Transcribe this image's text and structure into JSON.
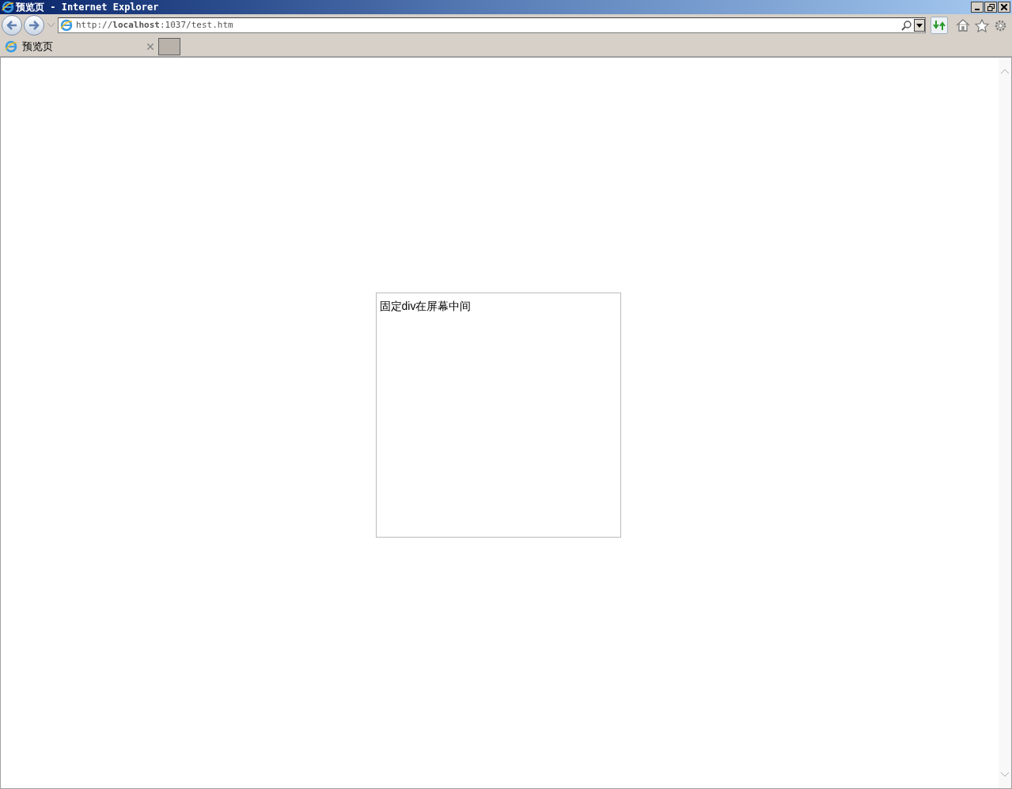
{
  "window": {
    "title": "预览页 - Internet Explorer"
  },
  "address_bar": {
    "url": "http://**localhost**:1037/test.htm"
  },
  "tabs": [
    {
      "label": "预览页",
      "selected": true
    }
  ],
  "page": {
    "box_text": "固定div在屏幕中间"
  }
}
